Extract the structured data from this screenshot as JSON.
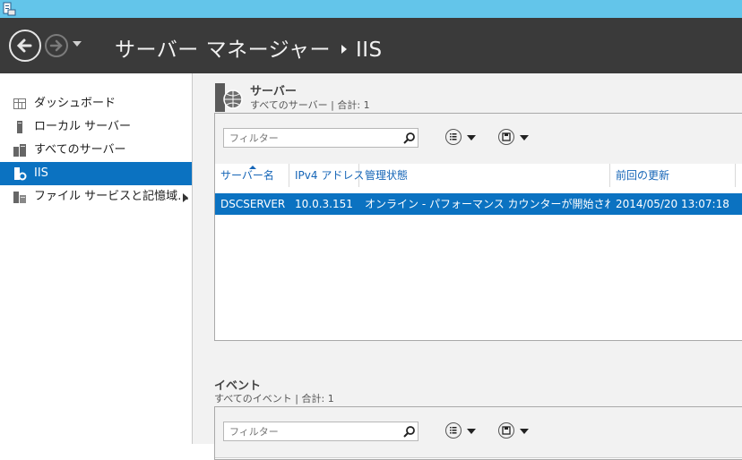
{
  "header": {
    "breadcrumb_root": "サーバー マネージャー",
    "breadcrumb_current": "IIS"
  },
  "sidebar": {
    "items": [
      {
        "label": "ダッシュボード",
        "icon": "dashboard-icon"
      },
      {
        "label": "ローカル サーバー",
        "icon": "local-server-icon"
      },
      {
        "label": "すべてのサーバー",
        "icon": "all-servers-icon"
      },
      {
        "label": "IIS",
        "icon": "iis-icon",
        "selected": true
      },
      {
        "label": "ファイル サービスと記憶域…",
        "icon": "file-services-icon",
        "has_submenu": true
      }
    ]
  },
  "servers_section": {
    "title": "サーバー",
    "subtitle": "すべてのサーバー | 合計: 1",
    "filter_placeholder": "フィルター",
    "columns": [
      "サーバー名",
      "IPv4 アドレス",
      "管理状態",
      "前回の更新",
      "("
    ],
    "rows": [
      {
        "server": "DSCSERVER",
        "ipv4": "10.0.3.151",
        "status": "オンライン - パフォーマンス カウンターが開始されていません",
        "last_update": "2014/05/20 13:07:18",
        "extra": "("
      }
    ]
  },
  "events_section": {
    "title": "イベント",
    "subtitle": "すべてのイベント | 合計: 1",
    "filter_placeholder": "フィルター"
  },
  "colors": {
    "titlebar": "#63c5ea",
    "header_bg": "#3a3a3a",
    "selection": "#0b72c1",
    "column_header_text": "#1565b7"
  }
}
